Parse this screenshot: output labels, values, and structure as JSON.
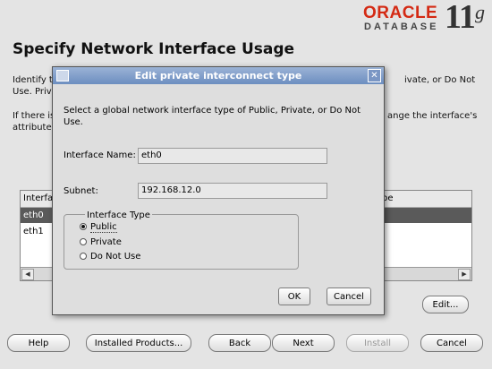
{
  "brand": {
    "oracle": "ORACLE",
    "database": "DATABASE",
    "version": "11",
    "version_suffix": "g"
  },
  "page": {
    "title": "Specify Network Interface Usage",
    "desc_line1_left": "Identify t",
    "desc_line1_right": "ivate, or Do Not",
    "desc_line2": "Use.  Priv",
    "desc_line3_left": "If there is",
    "desc_line3_right": "ange the interface's",
    "desc_line4": "attribute"
  },
  "table": {
    "col_left": "Interfa",
    "col_right": "pe",
    "rows": [
      {
        "name": "eth0",
        "selected": true
      },
      {
        "name": "eth1",
        "selected": false
      }
    ]
  },
  "buttons": {
    "edit": "Edit..."
  },
  "bottom_bar": {
    "help": "Help",
    "installed_products": "Installed Products...",
    "back": "Back",
    "next": "Next",
    "install": "Install",
    "cancel": "Cancel"
  },
  "dialog": {
    "title": "Edit private interconnect type",
    "instruction": "Select a global network interface type of Public, Private, or Do Not Use.",
    "interface_name_label": "Interface Name:",
    "interface_name_value": "eth0",
    "subnet_label": "Subnet:",
    "subnet_value": "192.168.12.0",
    "interface_type_label": "Interface Type",
    "options": [
      {
        "label": "Public",
        "selected": true
      },
      {
        "label": "Private",
        "selected": false
      },
      {
        "label": "Do Not Use",
        "selected": false
      }
    ],
    "ok": "OK",
    "cancel": "Cancel"
  },
  "colors": {
    "oracle_red": "#d42a14",
    "title_bar": "#7f9dca",
    "selected_row": "#5a5a5a"
  }
}
